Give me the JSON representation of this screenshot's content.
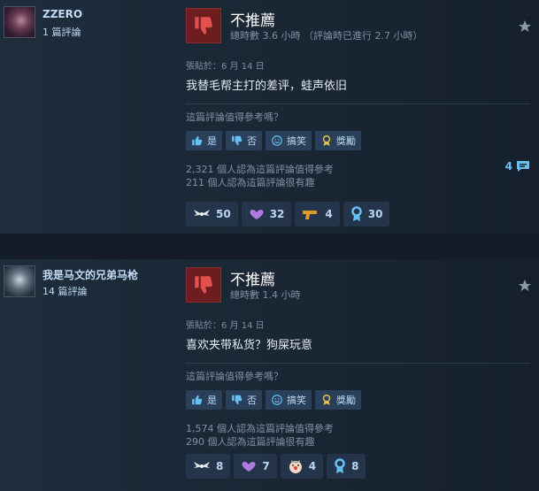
{
  "reviews": [
    {
      "username": "ZZERO",
      "review_count": "1 篇評論",
      "recommendation": "不推薦",
      "playtime": "總時數 3.6 小時 （評論時已進行 2.7 小時）",
      "posted": "張貼於：6 月 14 日",
      "text": "我替毛帮主打的差评，蛙声依旧",
      "helpful_question": "這篇評論值得參考嗎？",
      "buttons": {
        "yes": "是",
        "no": "否",
        "funny": "搞笑",
        "award": "獎勵"
      },
      "helpful_stat": "2,321 個人認為這篇評論值得參考",
      "funny_stat": "211 個人認為這篇評論很有趣",
      "comment_count": "4",
      "awards": [
        {
          "icon": "wings-award-icon",
          "count": "50"
        },
        {
          "icon": "heart-hands-award-icon",
          "count": "32"
        },
        {
          "icon": "gun-award-icon",
          "count": "4"
        },
        {
          "icon": "ribbon-award-icon",
          "count": "30"
        }
      ]
    },
    {
      "username": "我是马文的兄弟马枪",
      "review_count": "14 篇評論",
      "recommendation": "不推薦",
      "playtime": "總時數 1.4 小時",
      "posted": "張貼於：6 月 14 日",
      "text": "喜欢夹带私货？狗屎玩意",
      "helpful_question": "這篇評論值得參考嗎？",
      "buttons": {
        "yes": "是",
        "no": "否",
        "funny": "搞笑",
        "award": "獎勵"
      },
      "helpful_stat": "1,574 個人認為這篇評論值得參考",
      "funny_stat": "290 個人認為這篇評論很有趣",
      "awards": [
        {
          "icon": "wings-award-icon",
          "count": "8"
        },
        {
          "icon": "heart-hands-award-icon",
          "count": "7"
        },
        {
          "icon": "clown-award-icon",
          "count": "4"
        },
        {
          "icon": "ribbon-award-icon",
          "count": "8"
        }
      ]
    }
  ],
  "colors": {
    "background": "#1b2838",
    "accent": "#66c0f4",
    "thumb_down_bg": "#6d1d1d"
  }
}
